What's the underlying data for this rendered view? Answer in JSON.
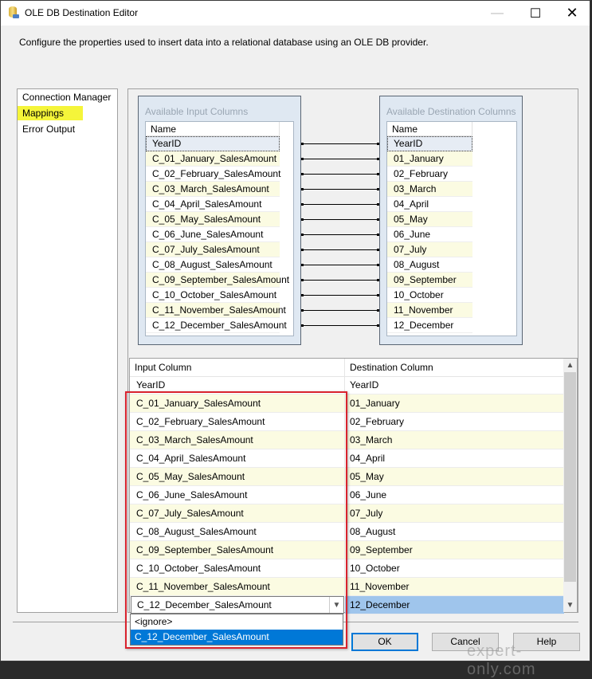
{
  "window": {
    "title": "OLE DB Destination Editor",
    "description": "Configure the properties used to insert data into a relational database using an OLE DB provider.",
    "controls": {
      "minimize": "—",
      "maximize": "☐",
      "close": "✕"
    }
  },
  "nav": {
    "items": [
      {
        "label": "Connection Manager",
        "selected": false
      },
      {
        "label": "Mappings",
        "selected": true
      },
      {
        "label": "Error Output",
        "selected": false
      }
    ]
  },
  "available_input": {
    "title": "Available Input Columns",
    "header": "Name",
    "items": [
      "YearID",
      "C_01_January_SalesAmount",
      "C_02_February_SalesAmount",
      "C_03_March_SalesAmount",
      "C_04_April_SalesAmount",
      "C_05_May_SalesAmount",
      "C_06_June_SalesAmount",
      "C_07_July_SalesAmount",
      "C_08_August_SalesAmount",
      "C_09_September_SalesAmount",
      "C_10_October_SalesAmount",
      "C_11_November_SalesAmount",
      "C_12_December_SalesAmount"
    ]
  },
  "available_destination": {
    "title": "Available Destination Columns",
    "header": "Name",
    "items": [
      "YearID",
      "01_January",
      "02_February",
      "03_March",
      "04_April",
      "05_May",
      "06_June",
      "07_July",
      "08_August",
      "09_September",
      "10_October",
      "11_November",
      "12_December"
    ]
  },
  "mapping_grid": {
    "headers": {
      "input": "Input Column",
      "destination": "Destination Column"
    },
    "rows": [
      {
        "input": "YearID",
        "destination": "YearID"
      },
      {
        "input": "C_01_January_SalesAmount",
        "destination": "01_January"
      },
      {
        "input": "C_02_February_SalesAmount",
        "destination": "02_February"
      },
      {
        "input": "C_03_March_SalesAmount",
        "destination": "03_March"
      },
      {
        "input": "C_04_April_SalesAmount",
        "destination": "04_April"
      },
      {
        "input": "C_05_May_SalesAmount",
        "destination": "05_May"
      },
      {
        "input": "C_06_June_SalesAmount",
        "destination": "06_June"
      },
      {
        "input": "C_07_July_SalesAmount",
        "destination": "07_July"
      },
      {
        "input": "C_08_August_SalesAmount",
        "destination": "08_August"
      },
      {
        "input": "C_09_September_SalesAmount",
        "destination": "09_September"
      },
      {
        "input": "C_10_October_SalesAmount",
        "destination": "10_October"
      },
      {
        "input": "C_11_November_SalesAmount",
        "destination": "11_November"
      },
      {
        "input": "C_12_December_SalesAmount",
        "destination": "12_December"
      }
    ],
    "dropdown_options": [
      "<ignore>",
      "C_12_December_SalesAmount"
    ],
    "dropdown_selected": "C_12_December_SalesAmount"
  },
  "buttons": {
    "ok": "OK",
    "cancel": "Cancel",
    "help": "Help"
  },
  "watermark": "expert-only.com",
  "colors": {
    "highlight_box": "#d9232e",
    "nav_highlight": "#f5f53a",
    "selection": "#0078d7"
  }
}
